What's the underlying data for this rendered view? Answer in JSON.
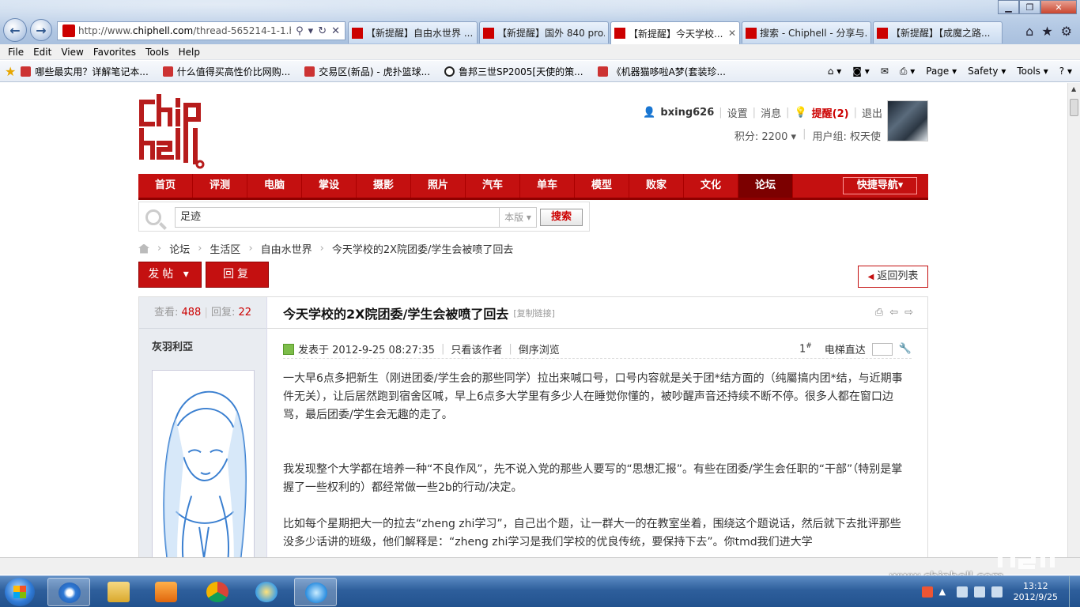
{
  "browser": {
    "url_prefix": "http://www.",
    "url_domain": "chiphell.com",
    "url_suffix": "/thread-565214-1-1.htr",
    "tabs": [
      {
        "label": "【新提醒】自由水世界 ..."
      },
      {
        "label": "【新提醒】国外 840 pro..."
      },
      {
        "label": "【新提醒】今天学校..."
      },
      {
        "label": "搜索 - Chiphell - 分享与..."
      },
      {
        "label": "【新提醒】【成魔之路..."
      }
    ],
    "menu": [
      "File",
      "Edit",
      "View",
      "Favorites",
      "Tools",
      "Help"
    ],
    "favorites": [
      "哪些最实用？详解笔记本...",
      "什么值得买高性价比网购...",
      "交易区(新品) - 虎扑篮球...",
      "鲁邦三世SP2005[天使的策...",
      "《机器猫哆啦A梦(套装珍..."
    ],
    "commands": [
      "Page ▾",
      "Safety ▾",
      "Tools ▾"
    ]
  },
  "user": {
    "name": "bxing626",
    "settings": "设置",
    "messages": "消息",
    "remind": "提醒(2)",
    "logout": "退出",
    "points_label": "积分: 2200",
    "group_label": "用户组: 权天使"
  },
  "nav": {
    "items": [
      "首页",
      "评测",
      "电脑",
      "掌设",
      "摄影",
      "照片",
      "汽车",
      "单车",
      "模型",
      "败家",
      "文化",
      "论坛"
    ],
    "quick": "快捷导航"
  },
  "search": {
    "value": "足迹",
    "scope": "本版",
    "button": "搜索"
  },
  "breadcrumb": [
    "论坛",
    "生活区",
    "自由水世界",
    "今天学校的2X院团委/学生会被喷了回去"
  ],
  "actions": {
    "post": "发帖",
    "reply": "回复",
    "back": "返回列表"
  },
  "thread": {
    "views_label": "查看:",
    "views": "488",
    "replies_label": "回复:",
    "replies": "22",
    "author": "灰羽利亞",
    "title": "今天学校的2X院团委/学生会被喷了回去",
    "copy_link": "[复制链接]",
    "posted": "发表于 2012-9-25 08:27:35",
    "only_author": "只看该作者",
    "reverse": "倒序浏览",
    "floor": "1",
    "floor_sup": "#",
    "elevator": "电梯直达",
    "paragraphs": [
      "一大早6点多把新生（刚进团委/学生会的那些同学）拉出来喊口号，口号内容就是关于团*结方面的（纯屬搞内团*结，与近期事件无关），让后居然跑到宿舍区喊，早上6点多大学里有多少人在睡觉你懂的，被吵醒声音还持续不断不停。很多人都在窗口边骂，最后团委/学生会无趣的走了。",
      "我发现整个大学都在培养一种“不良作风”，先不说入党的那些人要写的“思想汇报”。有些在团委/学生会任职的“干部”（特别是掌握了一些权利的）都经常做一些2b的行动/决定。",
      "比如每个星期把大一的拉去“zheng zhi学习”，自己出个题，让一群大一的在教室坐着，围绕这个题说话，然后就下去批评那些没多少话讲的班级，他们解释是：“zheng zhi学习是我们学校的优良传统，要保持下去”。你tmd我们进大学"
    ]
  },
  "watermark": "www.chiphell.com",
  "taskbar": {
    "time": "13:12",
    "date": "2012/9/25"
  }
}
